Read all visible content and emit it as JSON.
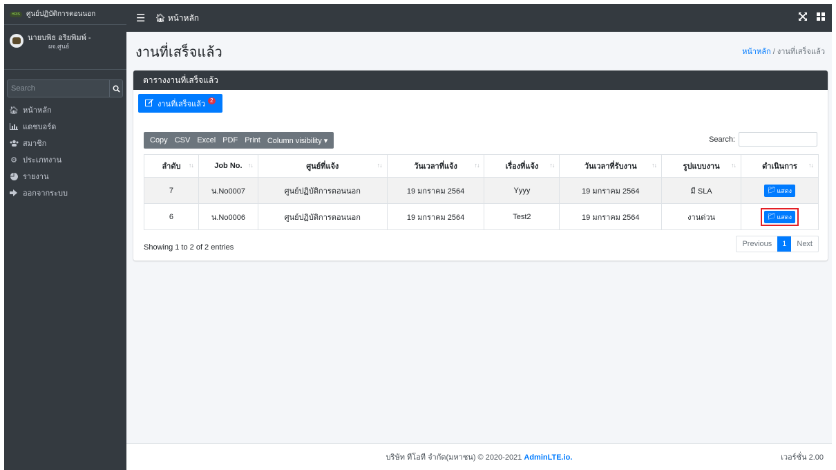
{
  "brand": {
    "logo_text": "HRIS",
    "title": "ศูนย์ปฏิบัติการตอนนอก"
  },
  "user": {
    "name": "นายบพิธ อริยพิมพ์ -",
    "role": "ผจ.ศูนย์"
  },
  "sidebar": {
    "search_placeholder": "Search",
    "items": [
      {
        "label": "หน้าหลัก",
        "icon": "home-icon"
      },
      {
        "label": "แดชบอร์ด",
        "icon": "chart-icon"
      },
      {
        "label": "สมาชิก",
        "icon": "users-icon"
      },
      {
        "label": "ประเภทงาน",
        "icon": "cogs-icon"
      },
      {
        "label": "รายงาน",
        "icon": "pie-chart-icon"
      },
      {
        "label": "ออกจากระบบ",
        "icon": "sign-out-icon"
      }
    ]
  },
  "topbar": {
    "home_label": "หน้าหลัก"
  },
  "page": {
    "title": "งานที่เสร็จแล้ว",
    "breadcrumb_home": "หน้าหลัก",
    "breadcrumb_sep": " / ",
    "breadcrumb_current": "งานที่เสร็จแล้ว"
  },
  "card": {
    "header": "ตารางงานที่เสร็จแล้ว",
    "tab_label": "งานที่เสร็จแล้ว",
    "tab_badge": "2"
  },
  "dt": {
    "buttons": [
      "Copy",
      "CSV",
      "Excel",
      "PDF",
      "Print",
      "Column visibility ▾"
    ],
    "search_label": "Search:",
    "columns": [
      "ลำดับ",
      "Job No.",
      "ศูนย์ที่แจ้ง",
      "วันเวลาที่แจ้ง",
      "เรื่องที่แจ้ง",
      "วันเวลาที่รับงาน",
      "รูปแบบงาน",
      "ดำเนินการ"
    ],
    "rows": [
      [
        "7",
        "น.No0007",
        "ศูนย์ปฏิบัติการตอนนอก",
        "19 มกราคม 2564",
        "Yyyy",
        "19 มกราคม 2564",
        "มี SLA"
      ],
      [
        "6",
        "น.No0006",
        "ศูนย์ปฏิบัติการตอนนอก",
        "19 มกราคม 2564",
        "Test2",
        "19 มกราคม 2564",
        "งานด่วน"
      ]
    ],
    "action_label": "แสดง",
    "info": "Showing 1 to 2 of 2 entries",
    "pager": {
      "prev": "Previous",
      "page": "1",
      "next": "Next"
    }
  },
  "footer": {
    "copyright": "บริษัท ทีโอที จำกัด(มหาชน) © 2020-2021 ",
    "link": "AdminLTE.io.",
    "version": "เวอร์ชั่น 2.00"
  }
}
